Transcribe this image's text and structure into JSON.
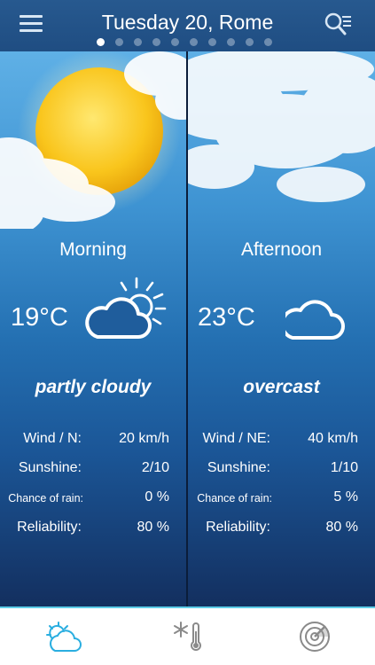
{
  "header": {
    "title": "Tuesday 20, Rome",
    "page_count": 10,
    "active_page": 1,
    "menu_icon": "hamburger-menu-icon",
    "search_icon": "search-list-icon"
  },
  "periods": [
    {
      "name": "Morning",
      "temperature": "19°C",
      "condition": "partly cloudy",
      "weather_icon": "partly-cloudy-icon",
      "stats": [
        {
          "label": "Wind / N:",
          "value": "20 km/h"
        },
        {
          "label": "Sunshine:",
          "value": "2/10"
        },
        {
          "label": "Chance of rain:",
          "value": "0 %"
        },
        {
          "label": "Reliability:",
          "value": "80 %"
        }
      ]
    },
    {
      "name": "Afternoon",
      "temperature": "23°C",
      "condition": "overcast",
      "weather_icon": "cloud-icon",
      "stats": [
        {
          "label": "Wind / NE:",
          "value": "40 km/h"
        },
        {
          "label": "Sunshine:",
          "value": "1/10"
        },
        {
          "label": "Chance of rain:",
          "value": "5 %"
        },
        {
          "label": "Reliability:",
          "value": "80 %"
        }
      ]
    }
  ],
  "tabbar": {
    "tabs": [
      {
        "icon": "sun-cloud-icon",
        "active": true
      },
      {
        "icon": "snowflake-thermometer-icon",
        "active": false
      },
      {
        "icon": "radar-icon",
        "active": false
      }
    ]
  },
  "colors": {
    "header": "#23558a",
    "accent": "#2aaee0",
    "tab_inactive": "#8a8a8a"
  }
}
